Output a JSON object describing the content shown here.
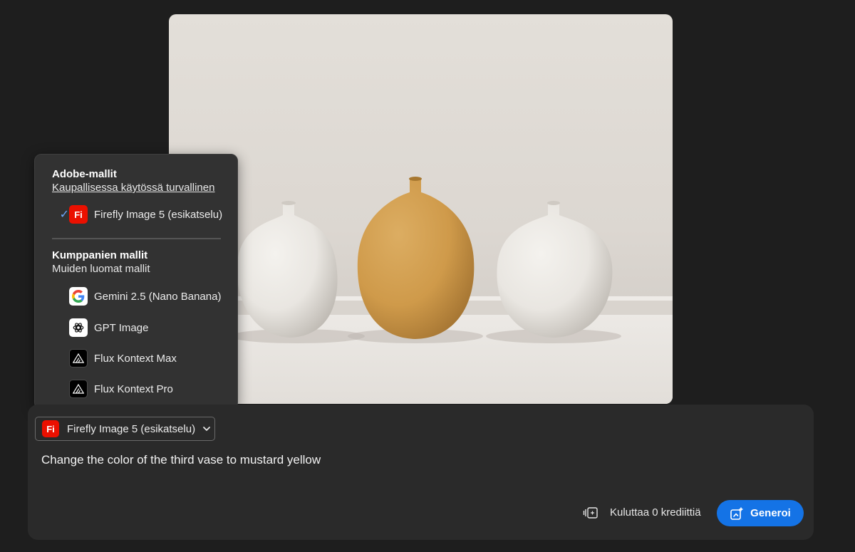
{
  "canvas": {
    "image_alt": ""
  },
  "model_menu": {
    "adobe_section_title": "Adobe-mallit",
    "adobe_section_subtitle": "Kaupallisessa käytössä turvallinen",
    "adobe_models": [
      {
        "label": "Firefly Image 5 (esikatselu)",
        "logo_text": "Fi",
        "icon": "firefly-logo-icon",
        "selected": true
      }
    ],
    "partner_section_title": "Kumppanien mallit",
    "partner_section_subtitle": "Muiden luomat mallit",
    "partner_models": [
      {
        "label": "Gemini 2.5 (Nano Banana)",
        "icon": "google-logo-icon"
      },
      {
        "label": "GPT Image",
        "icon": "openai-logo-icon"
      },
      {
        "label": "Flux Kontext Max",
        "icon": "flux-logo-icon"
      },
      {
        "label": "Flux Kontext Pro",
        "icon": "flux-logo-icon"
      }
    ],
    "check_glyph": "✓"
  },
  "prompt_panel": {
    "selected_model": {
      "label": "Firefly Image 5 (esikatselu)",
      "logo_text": "Fi"
    },
    "prompt_value": "Change the color of the third vase to mustard yellow",
    "credits_text": "Kuluttaa 0 krediittiä",
    "generate_label": "Generoi"
  },
  "colors": {
    "accent": "#1473e6",
    "firefly_red": "#eb1000",
    "check": "#6aa8ff",
    "panel_bg": "#2a2a2a",
    "page_bg": "#1e1e1e"
  }
}
